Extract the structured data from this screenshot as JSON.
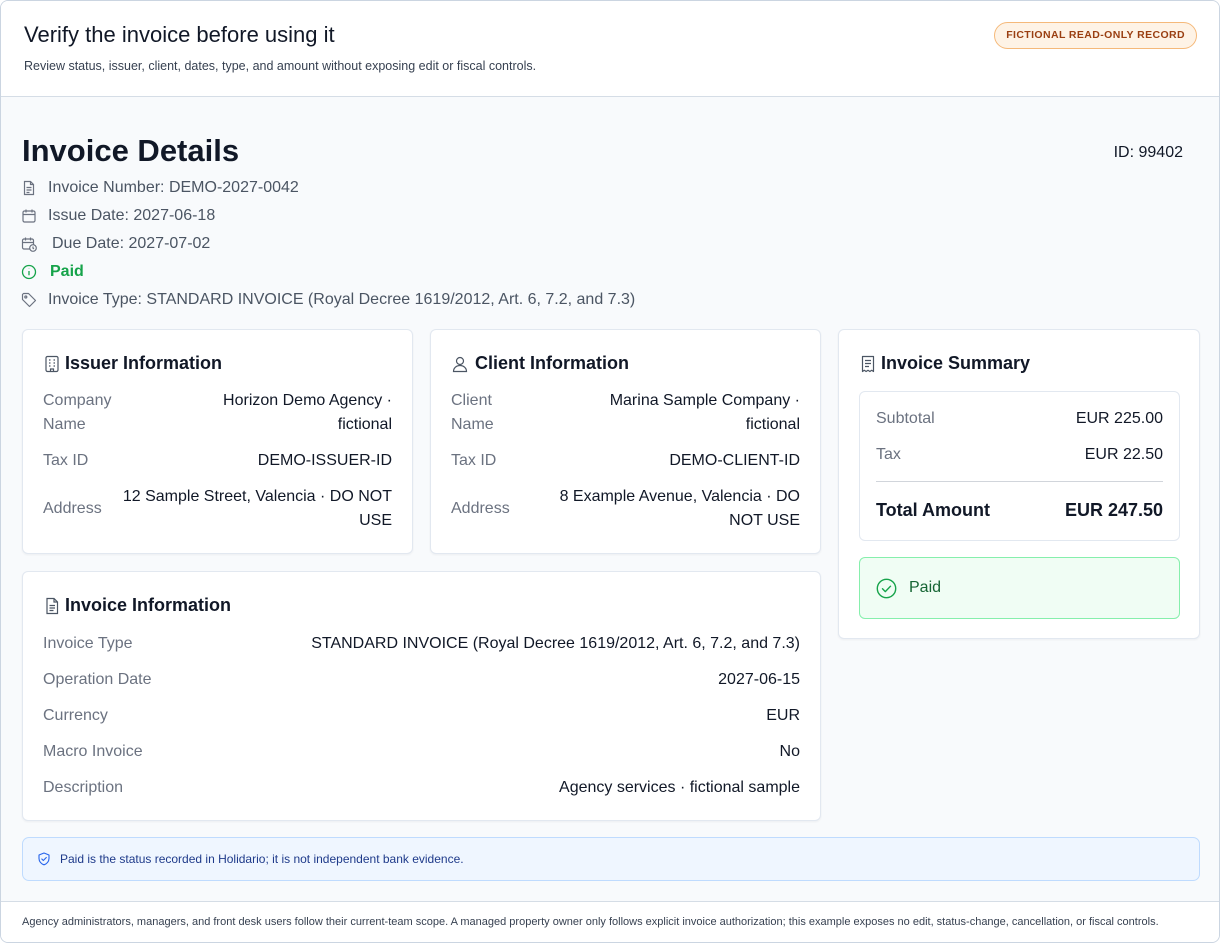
{
  "header": {
    "title": "Verify the invoice before using it",
    "subtitle": "Review status, issuer, client, dates, type, and amount without exposing edit or fiscal controls.",
    "badge": "FICTIONAL READ-ONLY RECORD"
  },
  "page": {
    "title": "Invoice Details",
    "record_id": "ID: 99402"
  },
  "meta": {
    "invoice_number": "Invoice Number: DEMO-2027-0042",
    "issue_date": "Issue Date: 2027-06-18",
    "due_date": "Due Date: 2027-07-02",
    "status": "Paid",
    "invoice_type": "Invoice Type: STANDARD INVOICE (Royal Decree 1619/2012, Art. 6, 7.2, and 7.3)"
  },
  "issuer": {
    "heading": "Issuer Information",
    "company_label": "Company Name",
    "company_value": "Horizon Demo Agency · fictional",
    "tax_label": "Tax ID",
    "tax_value": "DEMO-ISSUER-ID",
    "address_label": "Address",
    "address_value": "12 Sample Street, Valencia · DO NOT USE"
  },
  "client": {
    "heading": "Client Information",
    "name_label": "Client Name",
    "name_value": "Marina Sample Company · fictional",
    "tax_label": "Tax ID",
    "tax_value": "DEMO-CLIENT-ID",
    "address_label": "Address",
    "address_value": "8 Example Avenue, Valencia · DO NOT USE"
  },
  "invoice_info": {
    "heading": "Invoice Information",
    "rows": [
      {
        "label": "Invoice Type",
        "value": "STANDARD INVOICE (Royal Decree 1619/2012, Art. 6, 7.2, and 7.3)"
      },
      {
        "label": "Operation Date",
        "value": "2027-06-15"
      },
      {
        "label": "Currency",
        "value": "EUR"
      },
      {
        "label": "Macro Invoice",
        "value": "No"
      },
      {
        "label": "Description",
        "value": "Agency services · fictional sample"
      }
    ]
  },
  "summary": {
    "heading": "Invoice Summary",
    "subtotal_label": "Subtotal",
    "subtotal_value": "EUR 225.00",
    "tax_label": "Tax",
    "tax_value": "EUR 22.50",
    "total_label": "Total Amount",
    "total_value": "EUR 247.50",
    "status_label": "Paid"
  },
  "notice": {
    "text": "Paid is the status recorded in Holidario; it is not independent bank evidence."
  },
  "footer": {
    "text": "Agency administrators, managers, and front desk users follow their current-team scope. A managed property owner only follows explicit invoice authorization; this example exposes no edit, status-change, cancellation, or fiscal controls."
  },
  "colors": {
    "accent_paid": "#16a34a",
    "badge_bg": "#fef3e6",
    "badge_text": "#9a3f12",
    "notice_bg": "#eff6ff",
    "notice_text": "#1e3a8a"
  },
  "icons": {
    "invoice_number": "document-icon",
    "issue_date": "calendar-icon",
    "due_date": "calendar-clock-icon",
    "status": "info-icon",
    "invoice_type": "tag-icon",
    "issuer": "building-icon",
    "client": "user-icon",
    "invoice_info": "file-text-icon",
    "summary": "receipt-icon",
    "paid": "check-circle-icon",
    "notice": "shield-check-icon"
  }
}
